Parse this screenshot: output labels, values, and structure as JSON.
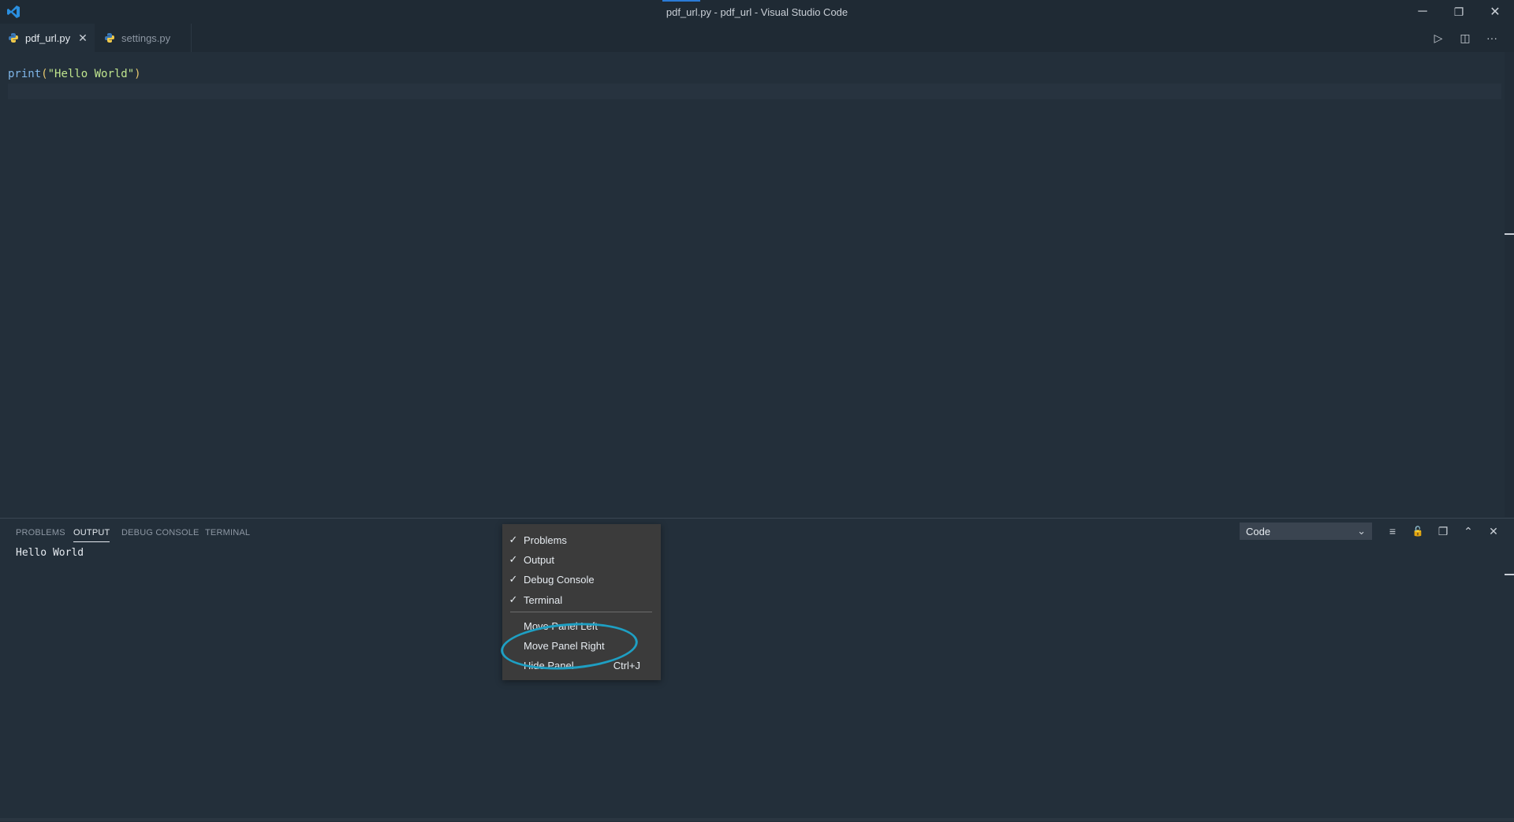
{
  "window": {
    "title": "pdf_url.py - pdf_url - Visual Studio Code",
    "controls": {
      "minimize": "─",
      "restore": "❐",
      "close": "✕"
    }
  },
  "tabs": [
    {
      "label": "pdf_url.py",
      "close": "✕"
    },
    {
      "label": "settings.py"
    }
  ],
  "editor_actions": {
    "run": "▷",
    "split": "◫",
    "more": "···"
  },
  "editor": {
    "line1": {
      "func": "print",
      "open": "(",
      "string": "\"Hello World\"",
      "close": ")"
    }
  },
  "panel": {
    "tabs": [
      {
        "label": "PROBLEMS"
      },
      {
        "label": "OUTPUT"
      },
      {
        "label": "DEBUG CONSOLE"
      },
      {
        "label": "TERMINAL"
      }
    ],
    "output_text": "Hello World",
    "channel_select": "Code",
    "controls": {
      "clear": "≡",
      "lock": "🔓",
      "copy": "❐",
      "maximize": "⌃",
      "close": "✕"
    }
  },
  "context_menu": {
    "items": [
      {
        "label": "Problems",
        "check": "✓"
      },
      {
        "label": "Output",
        "check": "✓"
      },
      {
        "label": "Debug Console",
        "check": "✓"
      },
      {
        "label": "Terminal",
        "check": "✓"
      },
      {
        "label": "Move Panel Left"
      },
      {
        "label": "Move Panel Right"
      },
      {
        "label": "Hide Panel",
        "shortcut": "Ctrl+J"
      }
    ]
  },
  "colors": {
    "background": "#232f3a",
    "titlebar": "#1f2a34",
    "menu": "#3b3b3b",
    "annotation": "#1e9fc3"
  }
}
